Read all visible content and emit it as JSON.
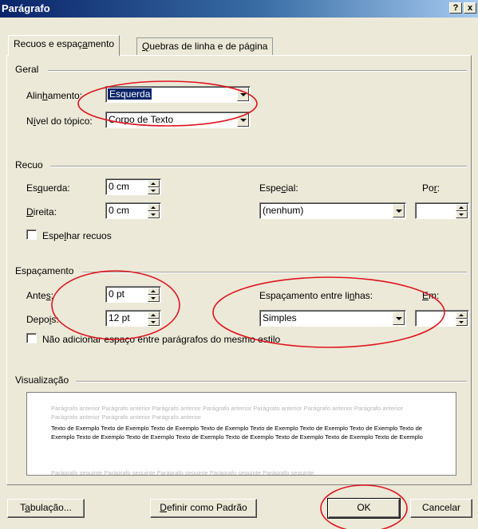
{
  "window": {
    "title": "Parágrafo",
    "help_label": "?",
    "close_label": "x"
  },
  "tabs": [
    {
      "pre": "Recuos e espaç",
      "u": "a",
      "post": "mento",
      "active": true
    },
    {
      "pre": "",
      "u": "Q",
      "post": "uebras de linha e de página",
      "active": false
    }
  ],
  "general": {
    "title": "Geral",
    "alignment": {
      "pre": "Alin",
      "u": "h",
      "post": "amento:",
      "value": "Esquerda"
    },
    "outline_level": {
      "pre": "N",
      "u": "í",
      "post": "vel do tópico:",
      "value": "Corpo de Texto"
    }
  },
  "indent": {
    "title": "Recuo",
    "left": {
      "pre": "Es",
      "u": "q",
      "post": "uerda:",
      "value": "0 cm"
    },
    "right": {
      "pre": "",
      "u": "D",
      "post": "ireita:",
      "value": "0 cm"
    },
    "special": {
      "pre": "Espe",
      "u": "c",
      "post": "ial:",
      "value": "(nenhum)"
    },
    "by": {
      "pre": "Po",
      "u": "r",
      "post": ":",
      "value": ""
    },
    "mirror": {
      "pre": "Espe",
      "u": "l",
      "post": "har recuos",
      "checked": false
    }
  },
  "spacing": {
    "title": "Espaçamento",
    "before": {
      "pre": "Ante",
      "u": "s",
      "post": ":",
      "value": "0 pt"
    },
    "after": {
      "pre": "Depo",
      "u": "i",
      "post": "s:",
      "value": "12 pt"
    },
    "line_spacing": {
      "pre": "Espaçamento entre li",
      "u": "n",
      "post": "has:",
      "value": "Simples"
    },
    "at": {
      "pre": "",
      "u": "E",
      "post": "m:",
      "value": ""
    },
    "no_space_same_style": {
      "label": "Não adicionar espaço entre parágrafos do mesmo estilo",
      "checked": false
    }
  },
  "preview": {
    "title": "Visualização",
    "previous_paragraph": "Parágrafo anterior Parágrafo anterior Parágrafo anterior Parágrafo anterior Parágrafo anterior Parágrafo anterior Parágrafo anterior Parágrafo anterior Parágrafo anterior Parágrafo anterior",
    "sample_text": "Texto de Exemplo Texto de Exemplo Texto de Exemplo Texto de Exemplo Texto de Exemplo Texto de Exemplo Texto de Exemplo Texto de Exemplo Texto de Exemplo Texto de Exemplo Texto de Exemplo Texto de Exemplo Texto de Exemplo Texto de Exemplo Texto de Exemplo",
    "next_paragraph": "Parágrafo seguinte Parágrafo seguinte Parágrafo seguinte Parágrafo seguinte Parágrafo seguinte"
  },
  "buttons": {
    "tabs": {
      "pre": "T",
      "u": "a",
      "post": "bulação..."
    },
    "set_default": {
      "pre": "",
      "u": "D",
      "post": "efinir como Padrão"
    },
    "ok": "OK",
    "cancel": "Cancelar"
  },
  "annotations": {
    "color": "#e0141e",
    "shape": "ellipse"
  }
}
